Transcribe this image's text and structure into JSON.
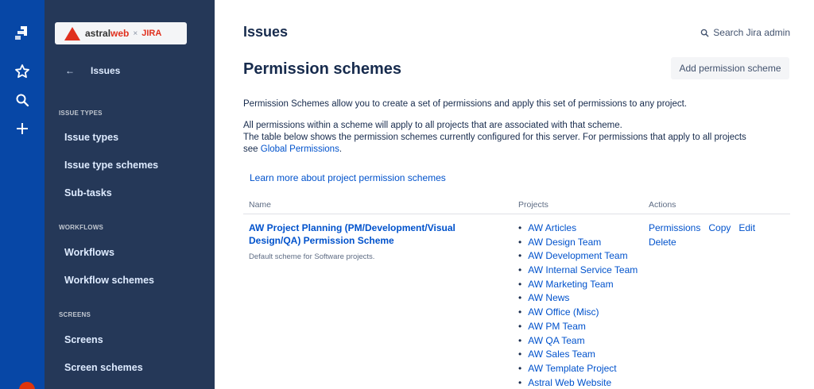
{
  "logo": {
    "brand_astral": "astral",
    "brand_web": "web",
    "separator": "×",
    "product": "JIRA"
  },
  "sidebar": {
    "back_label": "Issues",
    "sections": [
      {
        "title": "ISSUE TYPES",
        "items": [
          "Issue types",
          "Issue type schemes",
          "Sub-tasks"
        ]
      },
      {
        "title": "WORKFLOWS",
        "items": [
          "Workflows",
          "Workflow schemes"
        ]
      },
      {
        "title": "SCREENS",
        "items": [
          "Screens",
          "Screen schemes"
        ]
      }
    ]
  },
  "header": {
    "title": "Issues",
    "search_label": "Search Jira admin"
  },
  "page": {
    "title": "Permission schemes",
    "add_button": "Add permission scheme",
    "intro": "Permission Schemes allow you to create a set of permissions and apply this set of permissions to any project.",
    "line2": "All permissions within a scheme will apply to all projects that are associated with that scheme.",
    "line3": "The table below shows the permission schemes currently configured for this server. For permissions that apply to all projects",
    "line4_prefix": "see ",
    "global_link": "Global Permissions",
    "line4_suffix": ".",
    "learn_more": "Learn more about project permission schemes"
  },
  "table": {
    "columns": [
      "Name",
      "Projects",
      "Actions"
    ],
    "rows": [
      {
        "name": "AW Project Planning (PM/Development/Visual Design/QA) Permission Scheme",
        "description": "Default scheme for Software projects.",
        "projects": [
          "AW Articles",
          "AW Design Team",
          "AW Development Team",
          "AW Internal Service Team",
          "AW Marketing Team",
          "AW News",
          "AW Office (Misc)",
          "AW PM Team",
          "AW QA Team",
          "AW Sales Team",
          "AW Template Project",
          "Astral Web Website"
        ],
        "actions": [
          "Permissions",
          "Copy",
          "Edit",
          "Delete"
        ]
      }
    ]
  },
  "colors": {
    "rail": "#0747a6",
    "sidebar": "#253858",
    "link": "#0052cc",
    "brand": "#e0301e"
  },
  "icons": {
    "rail": [
      "jira-logo-icon",
      "star-icon",
      "search-icon",
      "plus-icon"
    ],
    "back": "arrow-left-icon",
    "search": "search-icon"
  }
}
